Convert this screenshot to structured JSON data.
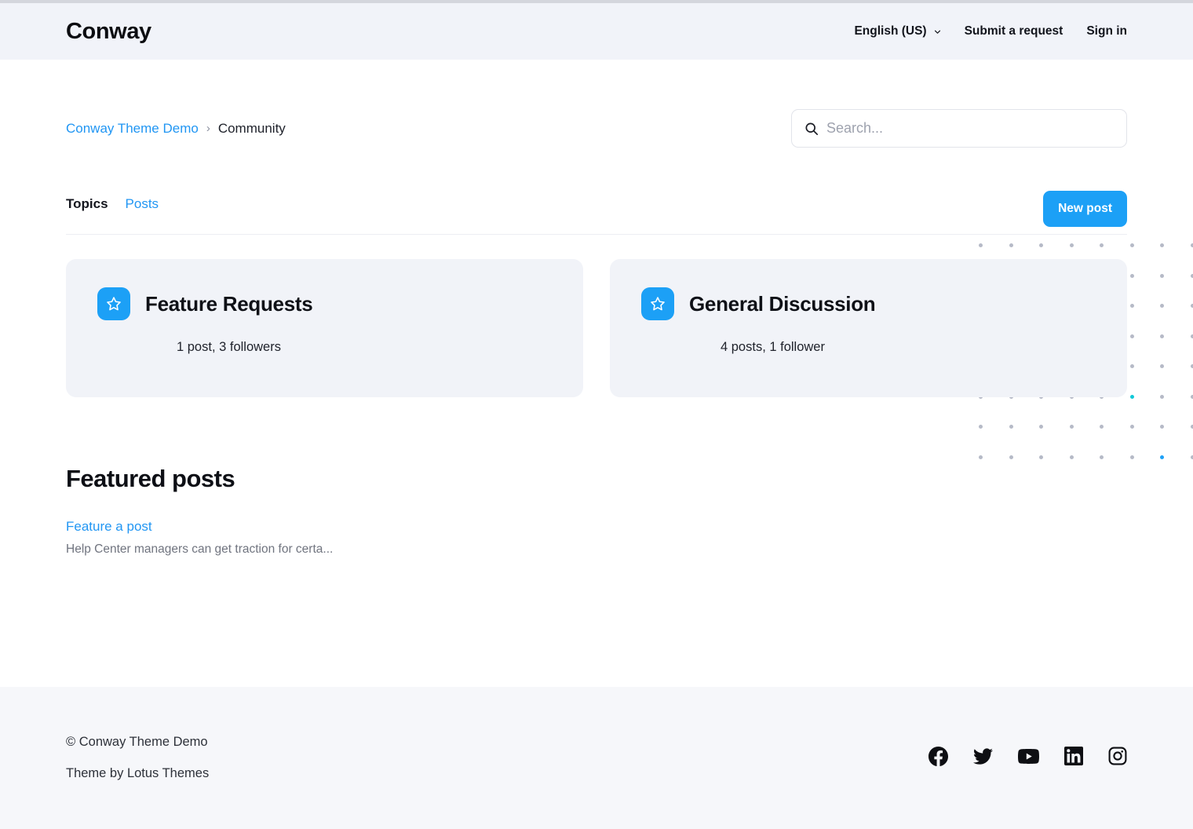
{
  "header": {
    "logo": "Conway",
    "language": "English (US)",
    "language_chevron_icon": "chevron-down-icon",
    "submit_request": "Submit a request",
    "sign_in": "Sign in"
  },
  "breadcrumb": {
    "root": "Conway Theme Demo",
    "separator": "›",
    "current": "Community"
  },
  "search": {
    "icon": "search-icon",
    "placeholder": "Search...",
    "value": ""
  },
  "tabs": [
    {
      "label": "Topics",
      "active": true
    },
    {
      "label": "Posts",
      "active": false
    }
  ],
  "actions": {
    "new_post": "New post"
  },
  "topics": [
    {
      "icon": "star-icon",
      "title": "Feature Requests",
      "meta": "1 post, 3 followers"
    },
    {
      "icon": "star-icon",
      "title": "General Discussion",
      "meta": "4 posts, 1 follower"
    }
  ],
  "featured": {
    "heading": "Featured posts",
    "posts": [
      {
        "title": "Feature a post",
        "excerpt": "Help Center managers can get traction for certa..."
      }
    ]
  },
  "footer": {
    "copyright": "© Conway Theme Demo",
    "theme_by": "Theme by Lotus Themes",
    "socials": [
      {
        "name": "facebook-icon"
      },
      {
        "name": "twitter-icon"
      },
      {
        "name": "youtube-icon"
      },
      {
        "name": "linkedin-icon"
      },
      {
        "name": "instagram-icon"
      }
    ]
  },
  "colors": {
    "accent": "#1ca0f6",
    "link": "#2196f3",
    "header_bg": "#f1f3f9",
    "card_bg": "#f1f3f8",
    "footer_bg": "#f6f7fa",
    "dot": "#b6bac7",
    "dot_accent_cyan": "#11c9d8",
    "dot_accent_blue": "#1ea1f7"
  }
}
